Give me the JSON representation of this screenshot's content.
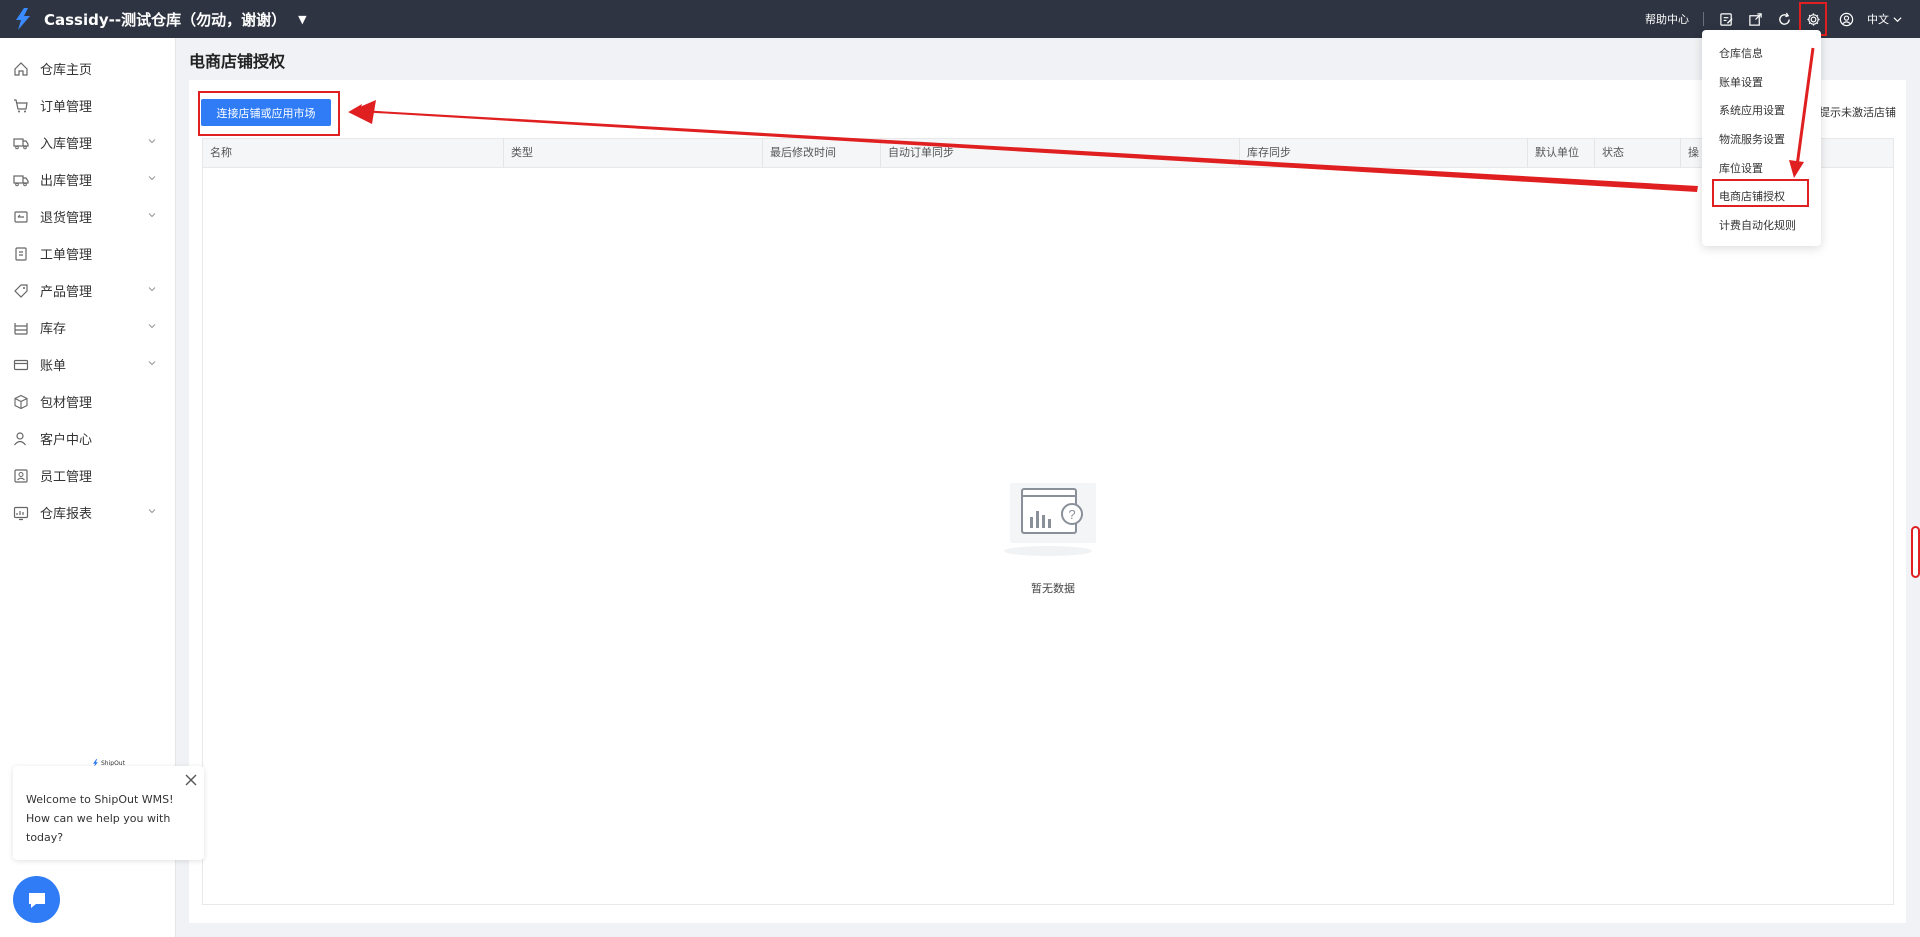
{
  "header": {
    "app_title": "Cassidy--测试仓库（勿动，谢谢）",
    "help_label": "帮助中心",
    "language": "中文",
    "icons": [
      "edit-icon",
      "export-icon",
      "refresh-icon",
      "gear-icon",
      "user-icon"
    ]
  },
  "sidebar": {
    "items": [
      {
        "label": "仓库主页",
        "icon": "home-icon",
        "expandable": false
      },
      {
        "label": "订单管理",
        "icon": "cart-icon",
        "expandable": false
      },
      {
        "label": "入库管理",
        "icon": "inbound-truck-icon",
        "expandable": true
      },
      {
        "label": "出库管理",
        "icon": "outbound-truck-icon",
        "expandable": true
      },
      {
        "label": "退货管理",
        "icon": "return-icon",
        "expandable": true
      },
      {
        "label": "工单管理",
        "icon": "ticket-icon",
        "expandable": false
      },
      {
        "label": "产品管理",
        "icon": "tag-icon",
        "expandable": true
      },
      {
        "label": "库存",
        "icon": "shelf-icon",
        "expandable": true
      },
      {
        "label": "账单",
        "icon": "card-icon",
        "expandable": true
      },
      {
        "label": "包材管理",
        "icon": "box-icon",
        "expandable": false
      },
      {
        "label": "客户中心",
        "icon": "customer-icon",
        "expandable": false
      },
      {
        "label": "员工管理",
        "icon": "staff-icon",
        "expandable": false
      },
      {
        "label": "仓库报表",
        "icon": "report-icon",
        "expandable": true
      }
    ]
  },
  "main": {
    "page_title": "电商店铺授权",
    "connect_button": "连接店铺或应用市场",
    "right_hint": "提示未激活店铺",
    "columns": [
      "名称",
      "类型",
      "最后修改时间",
      "自动订单同步",
      "库存同步",
      "默认单位",
      "状态",
      "操"
    ],
    "empty_text": "暂无数据"
  },
  "settings_menu": {
    "items": [
      "仓库信息",
      "账单设置",
      "系统应用设置",
      "物流服务设置",
      "库位设置",
      "电商店铺授权",
      "计费自动化规则"
    ],
    "highlighted_index": 5
  },
  "chat": {
    "brand": "ShipOut",
    "message": "Welcome to ShipOut WMS! How can we help you with today?"
  },
  "colors": {
    "topbar": "#2e3441",
    "primary": "#2f7cf6",
    "annotation": "#e02020"
  }
}
